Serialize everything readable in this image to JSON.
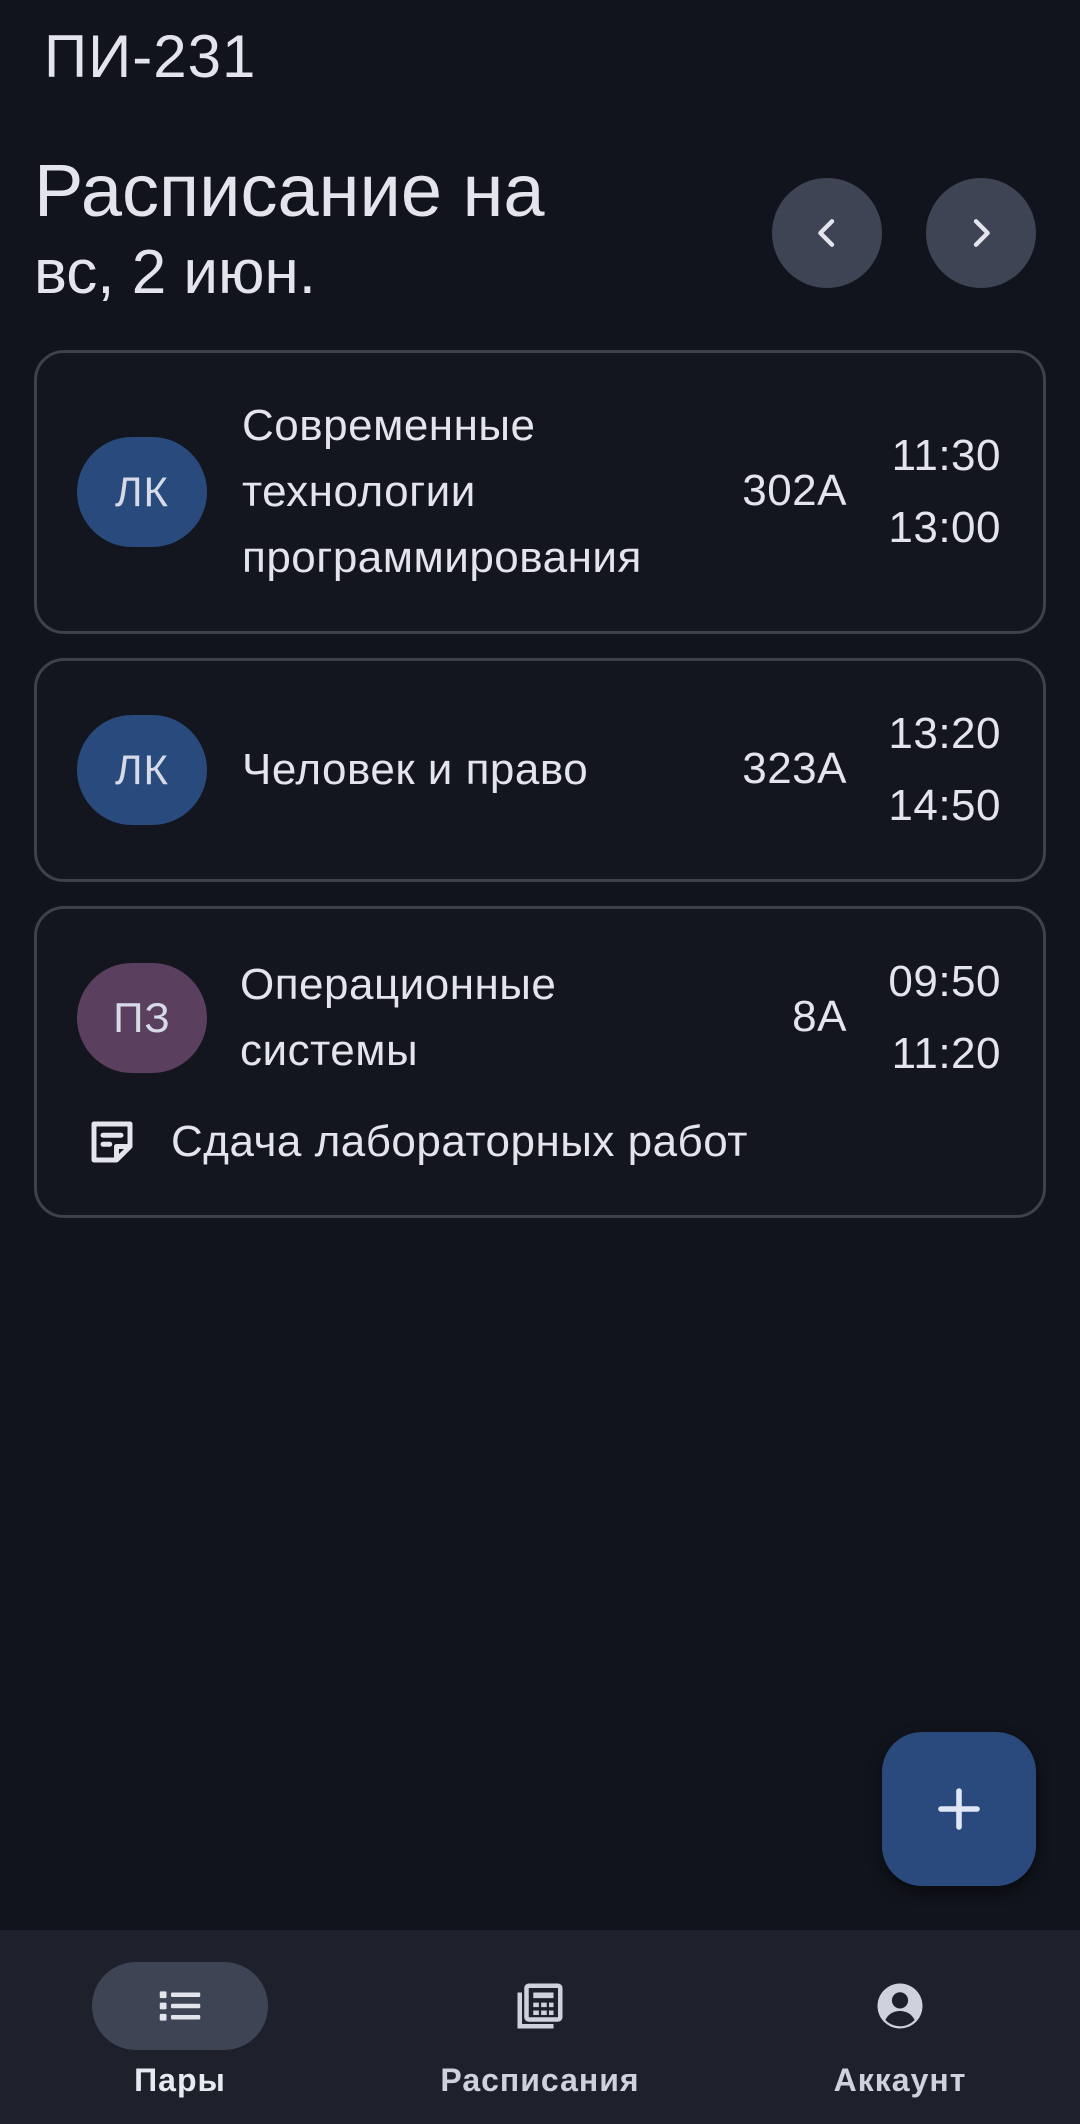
{
  "app": {
    "group": "ПИ-231"
  },
  "header": {
    "title": "Расписание на",
    "date": "вс, 2 июн.",
    "prev_icon": "chevron-left-icon",
    "next_icon": "chevron-right-icon"
  },
  "lessons": [
    {
      "type": "ЛК",
      "subject": "Современные технологии программирования",
      "room": "302А",
      "start": "11:30",
      "end": "13:00"
    },
    {
      "type": "ЛК",
      "subject": "Человек и право",
      "room": "323А",
      "start": "13:20",
      "end": "14:50"
    },
    {
      "type": "ПЗ",
      "subject": "Операционные системы",
      "room": "8А",
      "start": "09:50",
      "end": "11:20",
      "note": "Сдача лабораторных работ",
      "note_icon": "note-icon"
    }
  ],
  "fab": {
    "icon": "plus-icon"
  },
  "bottom_nav": {
    "items": [
      {
        "label": "Пары",
        "icon": "list-icon",
        "active": true
      },
      {
        "label": "Расписания",
        "icon": "calendar-grid-icon",
        "active": false
      },
      {
        "label": "Аккаунт",
        "icon": "account-circle-icon",
        "active": false
      }
    ]
  },
  "colors": {
    "background": "#11141c",
    "lecture_badge": "#284a7c",
    "practice_badge": "#5a3f5e",
    "fab": "#2a4a7e",
    "nav_bar": "#1e212b"
  }
}
